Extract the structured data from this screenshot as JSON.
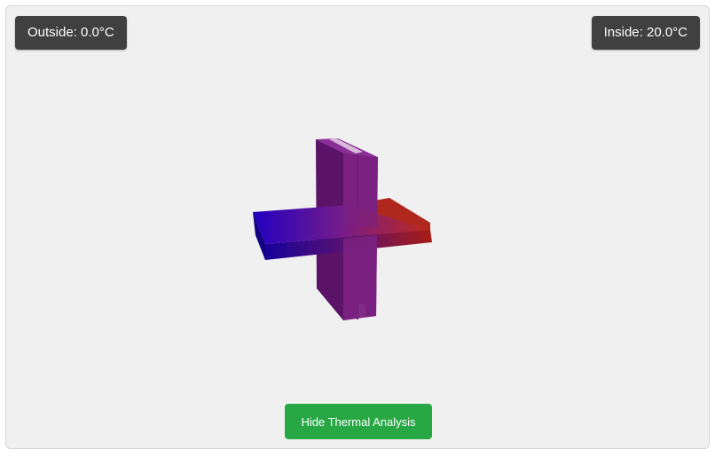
{
  "labels": {
    "outside": "Outside: 0.0°C",
    "inside": "Inside: 20.0°C"
  },
  "toggle_button": {
    "label": "Hide Thermal Analysis"
  },
  "colors": {
    "cold": "#1500b4",
    "mid": "#7a1f86",
    "hot": "#c0201c",
    "button": "#28a745",
    "label_bg": "#404040",
    "viewport_bg": "#f0f0f0"
  }
}
